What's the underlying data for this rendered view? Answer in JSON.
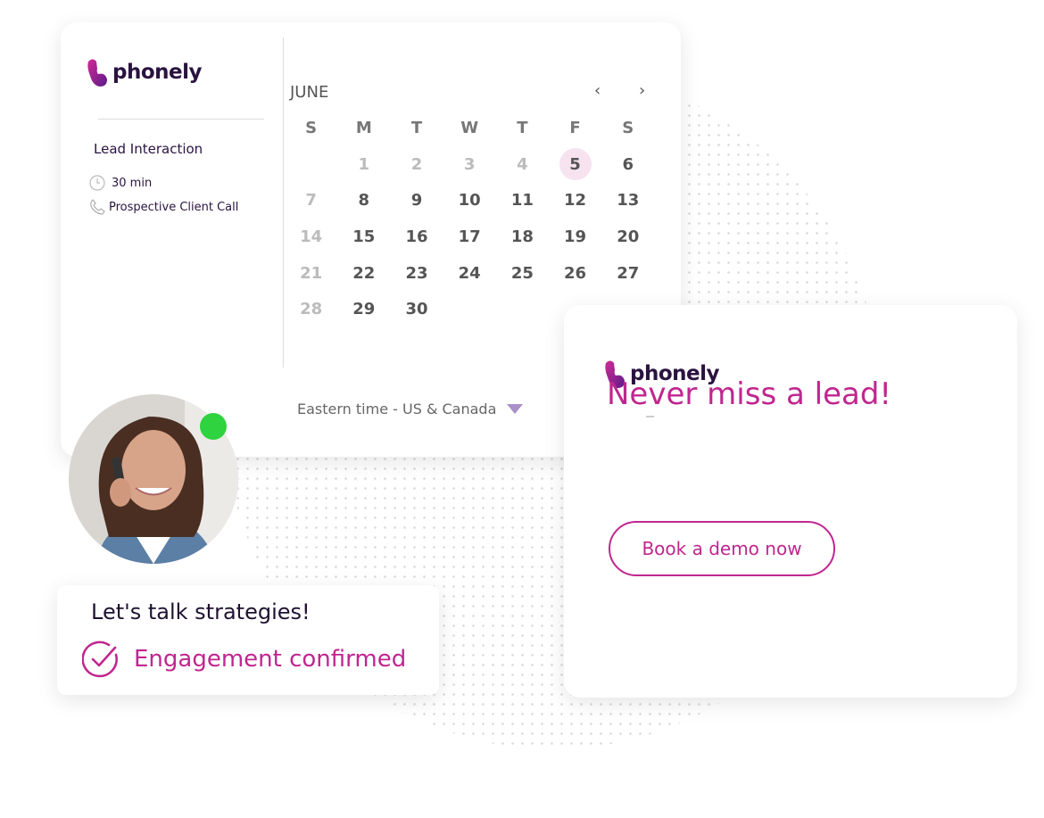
{
  "brand": {
    "name": "phonely",
    "accent": "#c0268f",
    "dark": "#2a1340"
  },
  "event": {
    "title": "Lead Interaction",
    "duration": "30 min",
    "type": "Prospective Client Call"
  },
  "calendar": {
    "month": "JUNE",
    "prev_icon": "chevron-left",
    "next_icon": "chevron-right",
    "weekdays": [
      "S",
      "M",
      "T",
      "W",
      "T",
      "F",
      "S"
    ],
    "leading_blanks": 1,
    "days": [
      {
        "d": "1",
        "state": "past"
      },
      {
        "d": "2",
        "state": "past"
      },
      {
        "d": "3",
        "state": "past"
      },
      {
        "d": "4",
        "state": "past"
      },
      {
        "d": "5",
        "state": "selected"
      },
      {
        "d": "6",
        "state": "available"
      },
      {
        "d": "7",
        "state": "past"
      },
      {
        "d": "8",
        "state": "available"
      },
      {
        "d": "9",
        "state": "available"
      },
      {
        "d": "10",
        "state": "available"
      },
      {
        "d": "11",
        "state": "available"
      },
      {
        "d": "12",
        "state": "available"
      },
      {
        "d": "13",
        "state": "available"
      },
      {
        "d": "14",
        "state": "past"
      },
      {
        "d": "15",
        "state": "available"
      },
      {
        "d": "16",
        "state": "available"
      },
      {
        "d": "17",
        "state": "available"
      },
      {
        "d": "18",
        "state": "available"
      },
      {
        "d": "19",
        "state": "available"
      },
      {
        "d": "20",
        "state": "available"
      },
      {
        "d": "21",
        "state": "past"
      },
      {
        "d": "22",
        "state": "available"
      },
      {
        "d": "23",
        "state": "available"
      },
      {
        "d": "24",
        "state": "available"
      },
      {
        "d": "25",
        "state": "available"
      },
      {
        "d": "26",
        "state": "available"
      },
      {
        "d": "27",
        "state": "available"
      },
      {
        "d": "28",
        "state": "past"
      },
      {
        "d": "29",
        "state": "available"
      },
      {
        "d": "30",
        "state": "available"
      }
    ],
    "timezone": "Eastern time - US & Canada"
  },
  "promo": {
    "headline": "Never miss a lead!",
    "cta": "Book a demo now"
  },
  "confirmation": {
    "title": "Let's talk strategies!",
    "status": "Engagement confirmed",
    "online_color": "#2fd23f"
  }
}
